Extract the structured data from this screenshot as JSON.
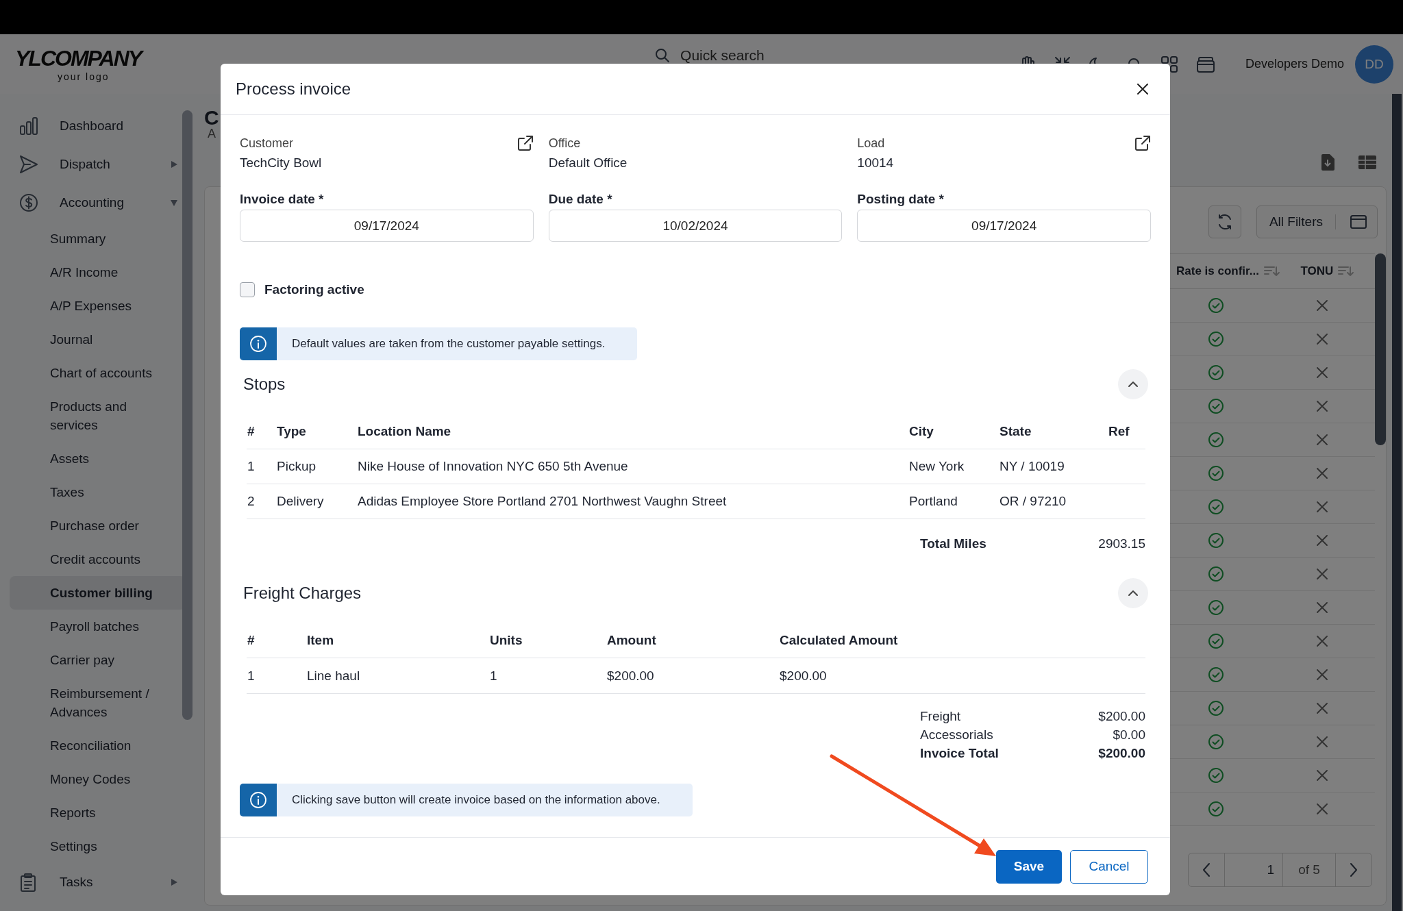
{
  "header": {
    "logo_text": "YLCOMPANY",
    "logo_subtext": "your logo",
    "search_placeholder": "Quick search",
    "user_name": "Developers Demo",
    "avatar_initials": "DD"
  },
  "sidebar": {
    "items": [
      {
        "label": "Dashboard",
        "kind": "chart"
      },
      {
        "label": "Dispatch",
        "kind": "send",
        "expanded": false
      },
      {
        "label": "Accounting",
        "kind": "dollar",
        "expanded": true,
        "children": [
          {
            "label": "Summary",
            "selected": false
          },
          {
            "label": "A/R Income",
            "selected": false
          },
          {
            "label": "A/P Expenses",
            "selected": false
          },
          {
            "label": "Journal",
            "selected": false
          },
          {
            "label": "Chart of accounts",
            "selected": false
          },
          {
            "label": "Products and services",
            "selected": false
          },
          {
            "label": "Assets",
            "selected": false
          },
          {
            "label": "Taxes",
            "selected": false
          },
          {
            "label": "Purchase order",
            "selected": false
          },
          {
            "label": "Credit accounts",
            "selected": false
          },
          {
            "label": "Customer billing",
            "selected": true
          },
          {
            "label": "Payroll batches",
            "selected": false
          },
          {
            "label": "Carrier pay",
            "selected": false
          },
          {
            "label": "Reimbursement / Advances",
            "selected": false
          },
          {
            "label": "Reconciliation",
            "selected": false
          },
          {
            "label": "Money Codes",
            "selected": false
          },
          {
            "label": "Reports",
            "selected": false
          },
          {
            "label": "Settings",
            "selected": false
          }
        ]
      },
      {
        "label": "Tasks",
        "kind": "clipboard",
        "expanded": false
      }
    ]
  },
  "page": {
    "title_fragment": "C",
    "tab_fragment": "A",
    "filters_button": "All Filters",
    "table": {
      "columns": [
        "Rate is confir...",
        "TONU"
      ],
      "rows": [
        {
          "rate_confirmed": true,
          "tonu": false
        },
        {
          "rate_confirmed": true,
          "tonu": false
        },
        {
          "rate_confirmed": true,
          "tonu": false
        },
        {
          "rate_confirmed": true,
          "tonu": false
        },
        {
          "rate_confirmed": true,
          "tonu": false
        },
        {
          "rate_confirmed": true,
          "tonu": false
        },
        {
          "rate_confirmed": true,
          "tonu": false
        },
        {
          "rate_confirmed": true,
          "tonu": false
        },
        {
          "rate_confirmed": true,
          "tonu": false
        },
        {
          "rate_confirmed": true,
          "tonu": false
        },
        {
          "rate_confirmed": true,
          "tonu": false
        },
        {
          "rate_confirmed": true,
          "tonu": false
        },
        {
          "rate_confirmed": true,
          "tonu": false
        },
        {
          "rate_confirmed": true,
          "tonu": false
        },
        {
          "rate_confirmed": true,
          "tonu": false
        },
        {
          "rate_confirmed": true,
          "tonu": false
        }
      ]
    },
    "pagination": {
      "page": "1",
      "total": "of 5"
    }
  },
  "dialog": {
    "title": "Process invoice",
    "info": [
      {
        "label": "Customer",
        "value": "TechCity Bowl",
        "link": true
      },
      {
        "label": "Office",
        "value": "Default Office",
        "link": false
      },
      {
        "label": "Load",
        "value": "10014",
        "link": true
      }
    ],
    "dates": [
      {
        "label": "Invoice date *",
        "value": "09/17/2024"
      },
      {
        "label": "Due date *",
        "value": "10/02/2024"
      },
      {
        "label": "Posting date *",
        "value": "09/17/2024"
      }
    ],
    "factoring": {
      "label": "Factoring active",
      "checked": false
    },
    "notice_top": "Default values are taken from the customer payable settings.",
    "stops": {
      "title": "Stops",
      "expanded": true,
      "columns": [
        "#",
        "Type",
        "Location Name",
        "City",
        "State",
        "Ref"
      ],
      "rows": [
        [
          "1",
          "Pickup",
          "Nike House of Innovation NYC 650 5th Avenue",
          "New York",
          "NY / 10019",
          ""
        ],
        [
          "2",
          "Delivery",
          "Adidas Employee Store Portland 2701 Northwest Vaughn Street",
          "Portland",
          "OR / 97210",
          ""
        ]
      ],
      "total_label": "Total Miles",
      "total_value": "2903.15"
    },
    "freight": {
      "title": "Freight Charges",
      "expanded": true,
      "columns": [
        "#",
        "Item",
        "Units",
        "Amount",
        "Calculated Amount"
      ],
      "rows": [
        [
          "1",
          "Line haul",
          "1",
          "$200.00",
          "$200.00"
        ]
      ],
      "totals": [
        {
          "label": "Freight",
          "value": "$200.00",
          "bold": false
        },
        {
          "label": "Accessorials",
          "value": "$0.00",
          "bold": false
        },
        {
          "label": "Invoice Total",
          "value": "$200.00",
          "bold": true
        }
      ]
    },
    "notice_bottom": "Clicking save button will create invoice based on the information above.",
    "buttons": [
      {
        "label": "Save",
        "kind": "primary"
      },
      {
        "label": "Cancel",
        "kind": "secondary"
      }
    ]
  }
}
